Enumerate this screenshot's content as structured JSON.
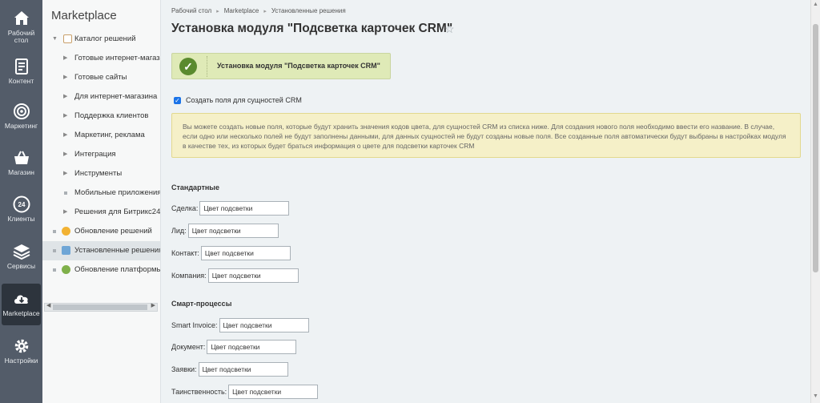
{
  "iconbar": {
    "items": [
      {
        "label": "Рабочий стол",
        "icon": "home-icon"
      },
      {
        "label": "Контент",
        "icon": "document-icon"
      },
      {
        "label": "Маркетинг",
        "icon": "target-icon"
      },
      {
        "label": "Магазин",
        "icon": "basket-icon"
      },
      {
        "label": "Клиенты",
        "icon": "clients-24-icon"
      },
      {
        "label": "Сервисы",
        "icon": "layers-icon"
      },
      {
        "label": "Marketplace",
        "icon": "cloud-download-icon",
        "active": true
      },
      {
        "label": "Настройки",
        "icon": "gear-icon"
      }
    ]
  },
  "sidebar": {
    "title": "Marketplace",
    "catalog": "Каталог решений",
    "items": [
      "Готовые интернет-магазины",
      "Готовые сайты",
      "Для интернет-магазина",
      "Поддержка клиентов",
      "Маркетинг, реклама",
      "Интеграция",
      "Инструменты",
      "Мобильные приложения",
      "Решения для Битрикс24"
    ],
    "updates": "Обновление решений",
    "installed": "Установленные решения",
    "platform": "Обновление платформы"
  },
  "breadcrumb": [
    "Рабочий стол",
    "Marketplace",
    "Установленные решения"
  ],
  "page_title": "Установка модуля \"Подсветка карточек CRM\"",
  "success_message": "Установка модуля \"Подсветка карточек CRM\"",
  "checkbox": {
    "label": "Создать поля для сущностей CRM",
    "checked": true
  },
  "notice": "Вы можете создать новые поля, которые будут хранить значения кодов цвета, для сущностей CRM из списка ниже. Для создания нового поля необходимо ввести его название. В случае, если одно или несколько полей не будут заполнены данными, для данных сущностей не будут созданы новые поля. Все созданные поля автоматически будут выбраны в настройках модуля в качестве тех, из которых будет браться информация о цвете для подсветки карточек CRM",
  "standard": {
    "title": "Стандартные",
    "fields": [
      {
        "label": "Сделка:",
        "value": "Цвет подсветки"
      },
      {
        "label": "Лид:",
        "value": "Цвет подсветки"
      },
      {
        "label": "Контакт:",
        "value": "Цвет подсветки"
      },
      {
        "label": "Компания:",
        "value": "Цвет подсветки"
      }
    ]
  },
  "smart": {
    "title": "Смарт-процессы",
    "fields": [
      {
        "label": "Smart Invoice:",
        "value": "Цвет подсветки"
      },
      {
        "label": "Документ:",
        "value": "Цвет подсветки"
      },
      {
        "label": "Заявки:",
        "value": "Цвет подсветки"
      },
      {
        "label": "Таинственность:",
        "value": "Цвет подсветки"
      }
    ]
  }
}
